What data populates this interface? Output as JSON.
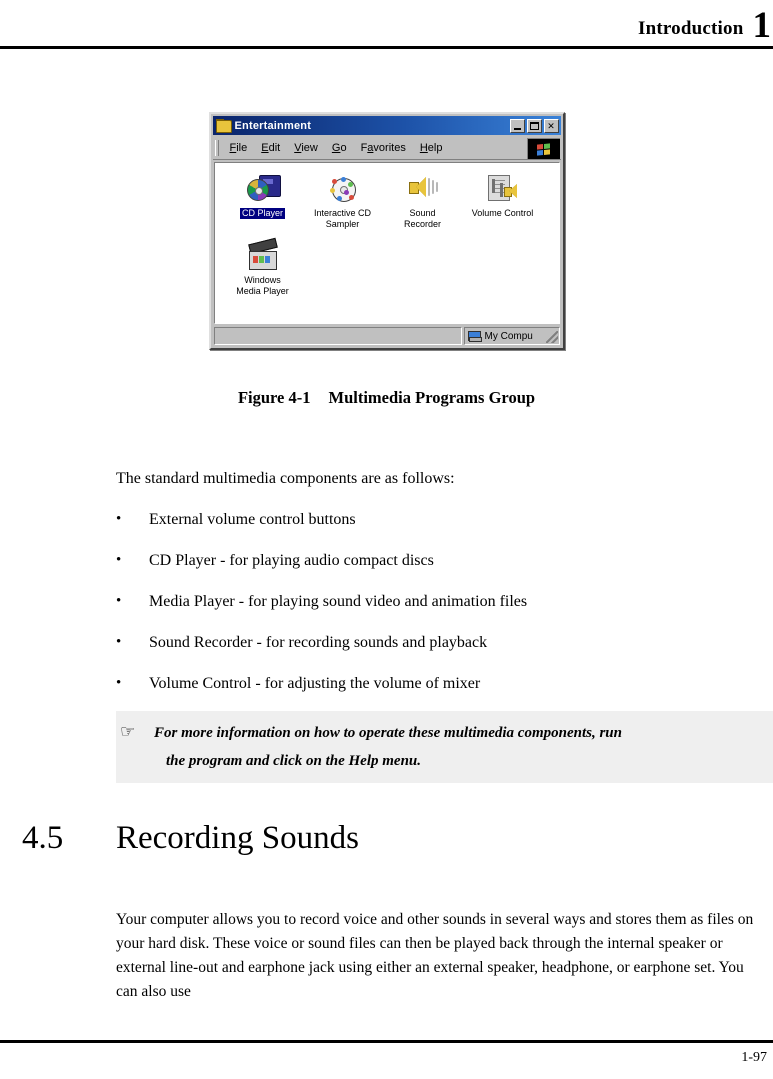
{
  "header": {
    "title": "Introduction",
    "chapter_number": "1"
  },
  "figure": {
    "caption_label": "Figure 4-1",
    "caption_title": "Multimedia Programs Group",
    "window": {
      "title": "Entertainment",
      "folder_icon": "folder-icon",
      "controls": {
        "minimize": "minimize-button",
        "maximize": "maximize-button",
        "close": "✕"
      },
      "menus": [
        {
          "label": "File",
          "accel": "F",
          "rest": "ile"
        },
        {
          "label": "Edit",
          "accel": "E",
          "rest": "dit"
        },
        {
          "label": "View",
          "accel": "V",
          "rest": "iew"
        },
        {
          "label": "Go",
          "accel": "G",
          "rest": "o"
        },
        {
          "label": "Favorites",
          "accel": "a",
          "pre": "F",
          "rest": "vorites"
        },
        {
          "label": "Help",
          "accel": "H",
          "rest": "elp"
        }
      ],
      "logo": "windows-logo-icon",
      "icons": [
        {
          "label_line1": "CD Player",
          "label_line2": "",
          "selected": true,
          "icon": "cd-player-icon"
        },
        {
          "label_line1": "Interactive CD",
          "label_line2": "Sampler",
          "selected": false,
          "icon": "interactive-cd-sampler-icon"
        },
        {
          "label_line1": "Sound",
          "label_line2": "Recorder",
          "selected": false,
          "icon": "sound-recorder-icon"
        },
        {
          "label_line1": "Volume Control",
          "label_line2": "",
          "selected": false,
          "icon": "volume-control-icon"
        },
        {
          "label_line1": "Windows",
          "label_line2": "Media Player",
          "selected": false,
          "icon": "windows-media-player-icon"
        }
      ],
      "statusbar": {
        "left_text": "",
        "right_text": "My Compu",
        "right_icon": "my-computer-icon"
      },
      "colors": {
        "titlebar_start": "#0a246a",
        "titlebar_end": "#3a82d8",
        "selection": "#000080",
        "face": "#c0c0c0"
      }
    }
  },
  "body": {
    "intro": "The standard multimedia components are as follows:",
    "bullet_char": "•",
    "bullets": [
      "External volume control buttons",
      "CD Player - for playing audio compact discs",
      "Media Player - for playing sound video and animation files",
      "Sound Recorder - for recording sounds and playback",
      "Volume Control - for adjusting the volume of mixer"
    ]
  },
  "note": {
    "icon": "☞",
    "icon_name": "pointing-hand-icon",
    "line1": "For more information on how to operate these multimedia components, run",
    "line2": "the program and click on the Help menu.",
    "background": "#efefef"
  },
  "section": {
    "number": "4.5",
    "title": "Recording Sounds"
  },
  "closing_paragraph": "Your computer allows you to record voice and other sounds in several ways and stores them as files on your hard disk. These voice or sound files can then be played back through the internal speaker or external line-out and earphone jack using either an external speaker, headphone, or earphone set. You can also use",
  "footer": {
    "page_number": "1-97"
  }
}
